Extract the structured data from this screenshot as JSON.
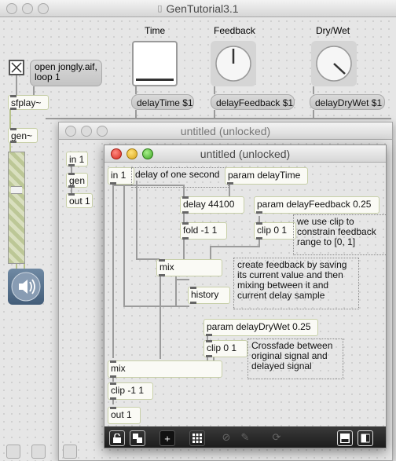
{
  "main_window": {
    "title": "GenTutorial3.1",
    "labels": {
      "time": "Time",
      "feedback": "Feedback",
      "drywet": "Dry/Wet"
    },
    "messages": {
      "open": "open jongly.aif, loop 1",
      "delay_time": "delayTime $1",
      "delay_feedback": "delayFeedback $1",
      "delay_drywet": "delayDryWet $1"
    },
    "objects": {
      "sfplay": "sfplay~",
      "gen": "gen~"
    }
  },
  "mid_window": {
    "title": "untitled (unlocked)",
    "objects": {
      "in": "in 1",
      "gen": "gen",
      "out": "out 1"
    }
  },
  "front_window": {
    "title": "untitled (unlocked)",
    "objects": {
      "in": "in 1",
      "param_time": "param delayTime",
      "delay": "delay 44100",
      "fold": "fold -1 1",
      "param_feedback": "param delayFeedback 0.25",
      "clip_fb": "clip 0 1",
      "mix1": "mix",
      "history": "history",
      "param_drywet": "param delayDryWet 0.25",
      "clip_dw": "clip 0 1",
      "mix2": "mix",
      "clip_out": "clip -1 1",
      "out": "out 1"
    },
    "comments": {
      "delay_comment": "delay of one second",
      "clip_comment": "we use clip to constrain feedback range to [0, 1]",
      "feedback_comment": "create feedback by saving its current value and then mixing between it and current delay sample",
      "crossfade_comment": "Crossfade between original signal and delayed signal"
    }
  },
  "ui": {
    "dial_feedback_angle": -90,
    "dial_drywet_angle": -45,
    "slider_fill": 1
  },
  "colors": {
    "accent_object_border": "#c7cfa8",
    "toolbar": "#1b1b1b"
  },
  "icons": [
    "lock-icon",
    "copy-icon",
    "add-icon",
    "grid-icon",
    "wrench-icon",
    "refresh-icon",
    "window-icon"
  ]
}
